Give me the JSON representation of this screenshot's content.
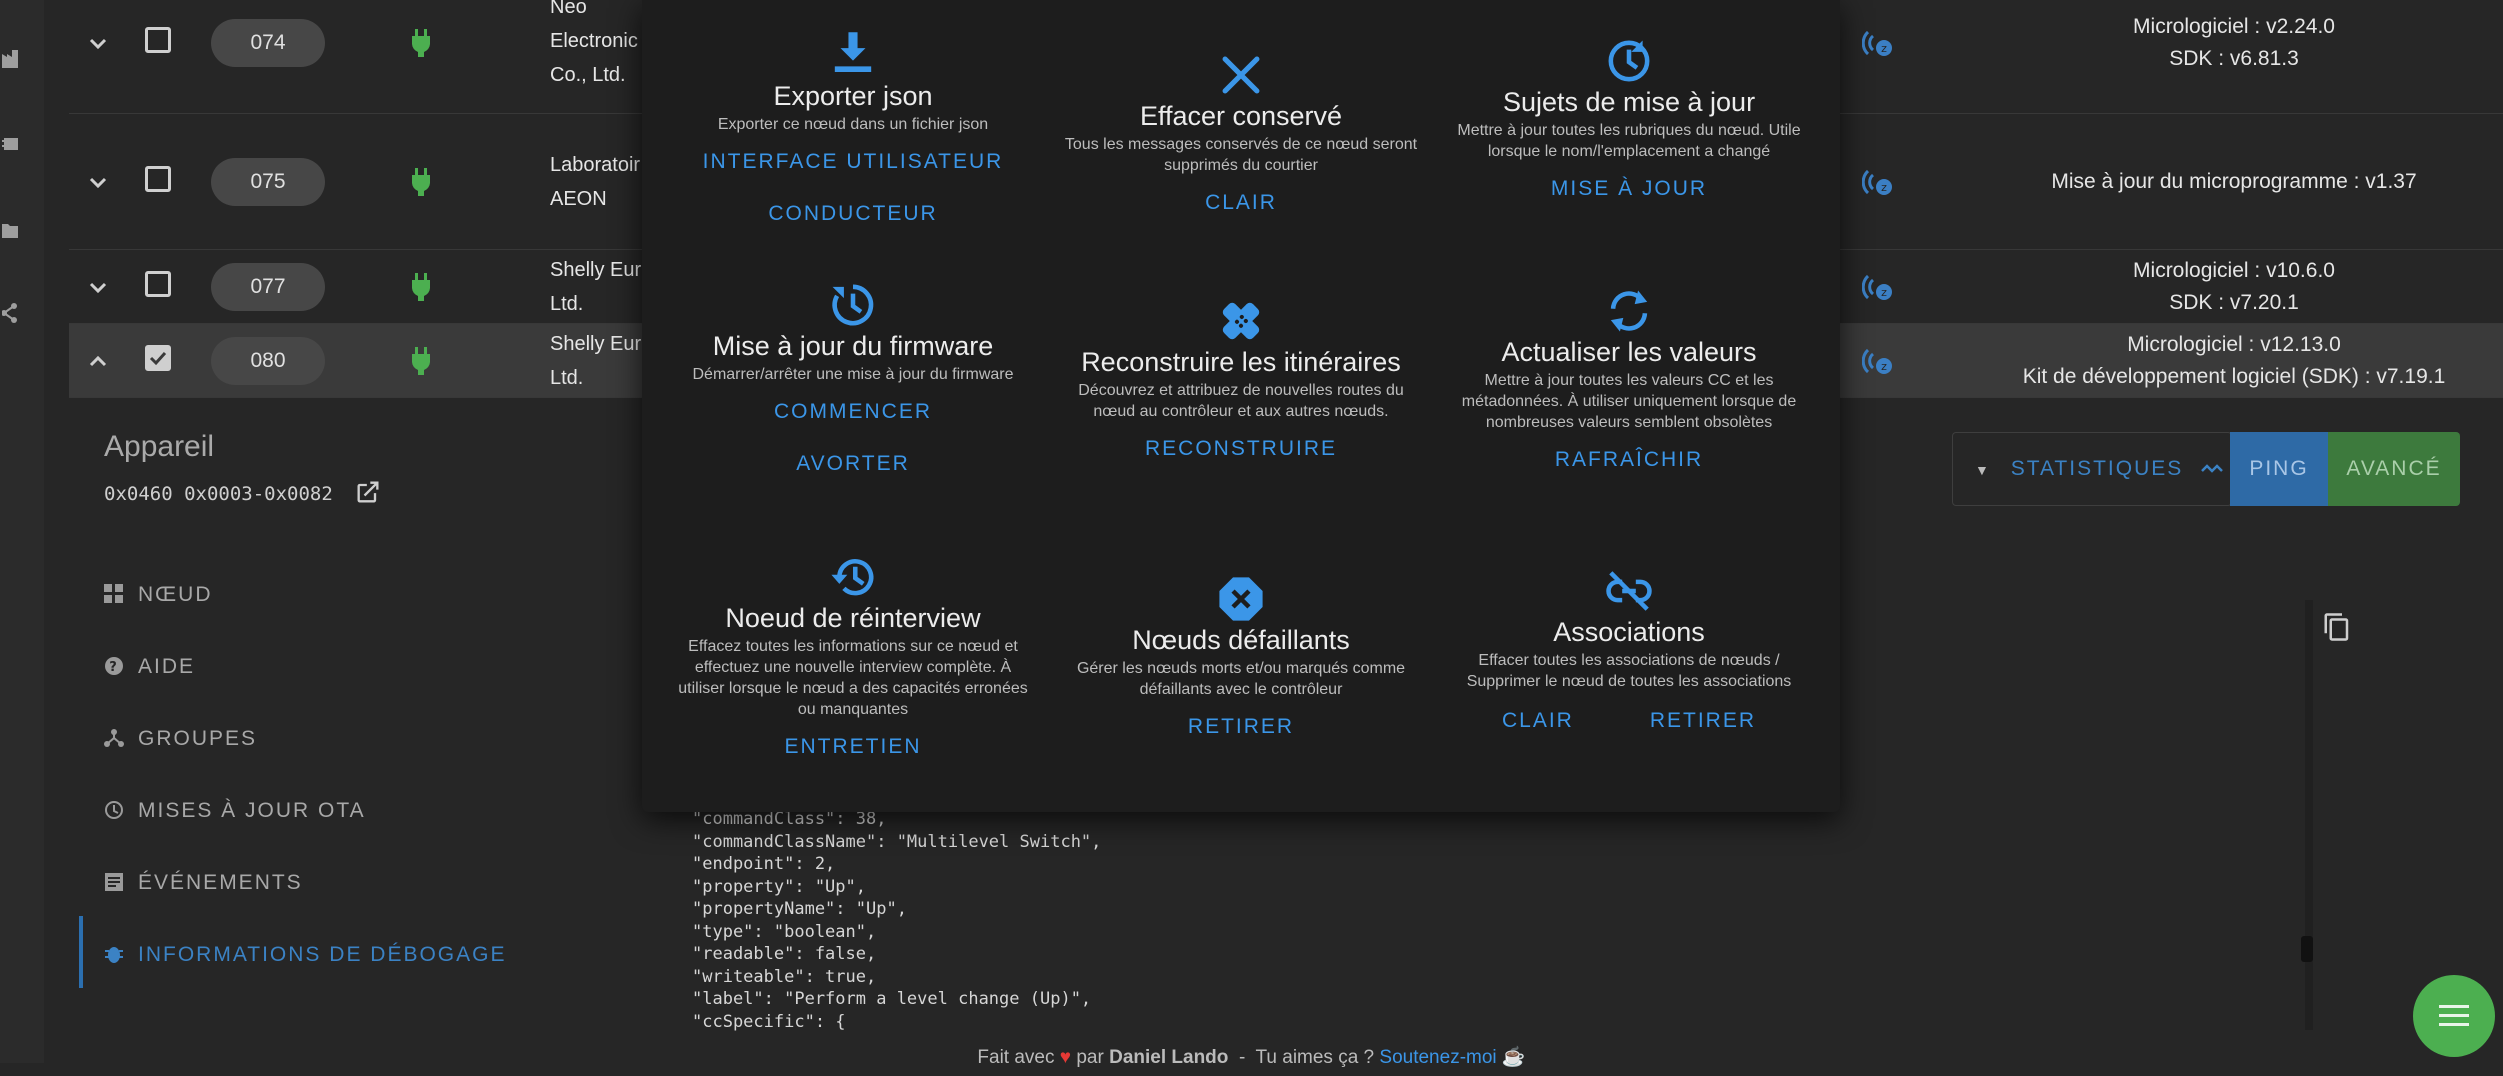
{
  "accent": "#3b96e8",
  "success_color": "#4caf50",
  "rows": [
    {
      "id": "074",
      "manufacturer_lines": [
        "Neo",
        "Electronic",
        "Co., Ltd."
      ],
      "fw_lines": [
        "Micrologiciel : v2.24.0",
        "SDK : v6.81.3"
      ],
      "expanded": false,
      "checked": false
    },
    {
      "id": "075",
      "manufacturer_lines": [
        "Laboratoir",
        "AEON"
      ],
      "fw_lines": [
        "Mise à jour du microprogramme : v1.37"
      ],
      "expanded": false,
      "checked": false
    },
    {
      "id": "077",
      "manufacturer_lines": [
        "Shelly Eur",
        "Ltd."
      ],
      "fw_lines": [
        "Micrologiciel : v10.6.0",
        "SDK : v7.20.1"
      ],
      "expanded": false,
      "checked": false
    },
    {
      "id": "080",
      "manufacturer_lines": [
        "Shelly Eur",
        "Ltd."
      ],
      "fw_lines": [
        "Micrologiciel : v12.13.0",
        "Kit de développement logiciel (SDK) : v7.19.1"
      ],
      "expanded": true,
      "checked": true
    }
  ],
  "device": {
    "title": "Appareil",
    "code": "0x0460 0x0003-0x0082"
  },
  "nav": [
    {
      "label": "NŒUD",
      "icon": "node-icon"
    },
    {
      "label": "AIDE",
      "icon": "help-icon"
    },
    {
      "label": "GROUPES",
      "icon": "groups-icon"
    },
    {
      "label": "MISES À JOUR OTA",
      "icon": "ota-icon"
    },
    {
      "label": "ÉVÉNEMENTS",
      "icon": "events-icon"
    },
    {
      "label": "INFORMATIONS DE DÉBOGAGE",
      "icon": "debug-icon",
      "active": true
    }
  ],
  "actions": {
    "stats": "STATISTIQUES",
    "ping": "PING",
    "advanced": "AVANCÉ"
  },
  "code_lines": [
    "\"commandClass\": 38,",
    "\"commandClassName\": \"Multilevel Switch\",",
    "\"endpoint\": 2,",
    "\"property\": \"Up\",",
    "\"propertyName\": \"Up\",",
    "\"type\": \"boolean\",",
    "\"readable\": false,",
    "\"writeable\": true,",
    "\"label\": \"Perform a level change (Up)\",",
    "\"ccSpecific\": {"
  ],
  "footer": {
    "made_with": "Fait avec",
    "by": "par",
    "author": "Daniel Lando",
    "like": "Tu aimes ça ?",
    "support": "Soutenez-moi"
  },
  "modal": {
    "cards": [
      {
        "icon": "download-icon",
        "title": "Exporter json",
        "desc": "Exporter ce nœud dans un fichier json",
        "buttons": [
          "INTERFACE UTILISATEUR",
          "CONDUCTEUR"
        ]
      },
      {
        "icon": "close-icon",
        "title": "Effacer conservé",
        "desc": "Tous les messages conservés de ce nœud seront supprimés du courtier",
        "buttons": [
          "CLAIR"
        ]
      },
      {
        "icon": "update-icon",
        "title": "Sujets de mise à jour",
        "desc": "Mettre à jour toutes les rubriques du nœud. Utile lorsque le nom/l'emplacement a changé",
        "buttons": [
          "MISE À JOUR"
        ]
      },
      {
        "icon": "firmware-update-icon",
        "title": "Mise à jour du firmware",
        "desc": "Démarrer/arrêter une mise à jour du firmware",
        "buttons": [
          "COMMENCER",
          "AVORTER"
        ]
      },
      {
        "icon": "bandage-icon",
        "title": "Reconstruire les itinéraires",
        "desc": "Découvrez et attribuez de nouvelles routes du nœud au contrôleur et aux autres nœuds.",
        "buttons": [
          "RECONSTRUIRE"
        ]
      },
      {
        "icon": "refresh-icon",
        "title": "Actualiser les valeurs",
        "desc": "Mettre à jour toutes les valeurs CC et les métadonnées. À utiliser uniquement lorsque de nombreuses valeurs semblent obsolètes",
        "buttons": [
          "RAFRAÎCHIR"
        ]
      },
      {
        "icon": "history-icon",
        "title": "Noeud de réinterview",
        "desc": "Effacez toutes les informations sur ce nœud et effectuez une nouvelle interview complète. À utiliser lorsque le nœud a des capacités erronées ou manquantes",
        "buttons": [
          "ENTRETIEN"
        ]
      },
      {
        "icon": "failed-node-icon",
        "title": "Nœuds défaillants",
        "desc": "Gérer les nœuds morts et/ou marqués comme défaillants avec le contrôleur",
        "buttons": [
          "RETIRER"
        ]
      },
      {
        "icon": "link-off-icon",
        "title": "Associations",
        "desc": "Effacer toutes les associations de nœuds / Supprimer le nœud de toutes les associations",
        "buttons": [
          "CLAIR",
          "RETIRER"
        ]
      }
    ]
  }
}
